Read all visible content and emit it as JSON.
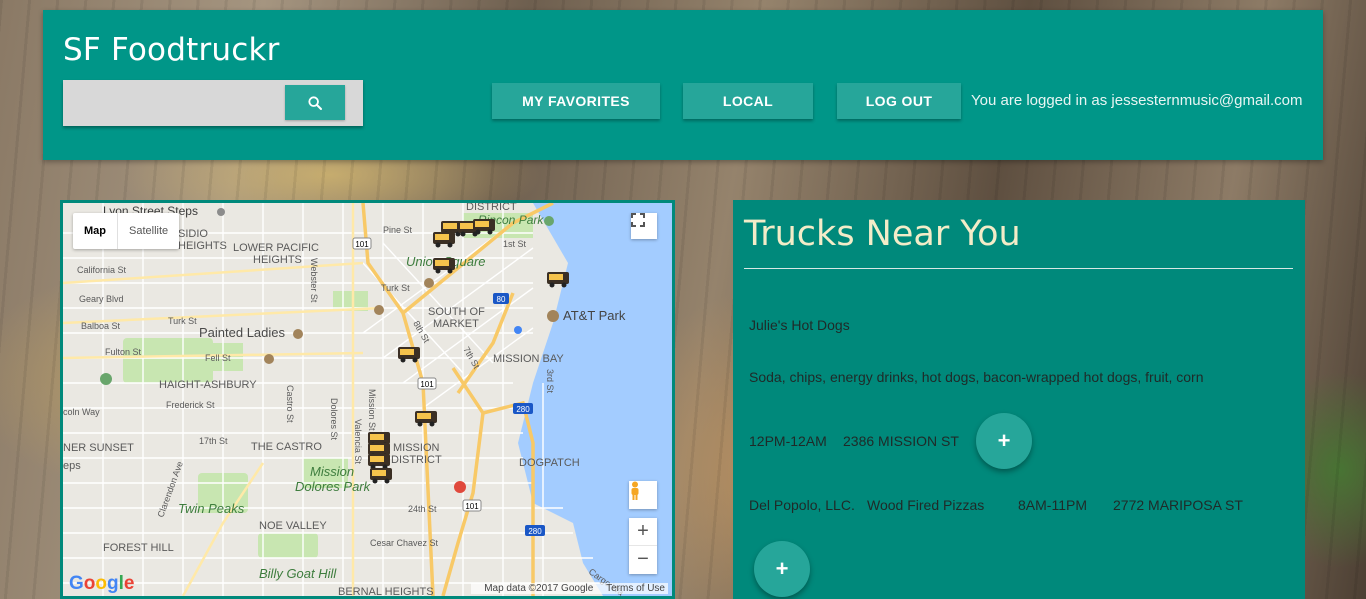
{
  "header": {
    "title": "SF Foodtruckr",
    "search": {
      "value": "",
      "placeholder": ""
    },
    "buttons": {
      "favorites": "MY FAVORITES",
      "local": "LOCAL",
      "logout": "LOG OUT"
    },
    "login_status": "You are logged in as jessesternmusic@gmail.com"
  },
  "map": {
    "type_options": [
      "Map",
      "Satellite"
    ],
    "selected_type": "Map",
    "logo": "Google",
    "attribution": "Map data ©2017 Google",
    "terms": "Terms of Use",
    "labels": {
      "lyon": "Lyon Street Steps",
      "presidio": "SIDIO",
      "heights": "HEIGHTS",
      "lower_pacific": "LOWER PACIFIC",
      "lower_pacific2": "HEIGHTS",
      "california": "California St",
      "geary": "Geary Blvd",
      "balboa": "Balboa St",
      "turk": "Turk St",
      "fulton": "Fulton St",
      "fell": "Fell St",
      "painted_ladies": "Painted Ladies",
      "haight": "HAIGHT-ASHBURY",
      "frederick": "Frederick St",
      "lincoln": "coln Way",
      "inner_sunset": "NER SUNSET",
      "eps": "eps",
      "st17": "17th St",
      "castro": "THE CASTRO",
      "mission_district": "MISSION",
      "mission_district2": "DISTRICT",
      "mission_dolores": "Mission",
      "mission_dolores2": "Dolores Park",
      "twin_peaks": "Twin Peaks",
      "noe_valley": "NOE VALLEY",
      "forest_hill": "FOREST HILL",
      "billy_goat": "Billy Goat Hill",
      "bernal": "BERNAL HEIGHTS",
      "cesar": "Cesar Chavez St",
      "st24": "24th St",
      "pine": "Pine St",
      "union_square": "Union Square",
      "turk2": "Turk St",
      "south_market": "SOUTH OF",
      "south_market2": "MARKET",
      "att_park": "AT&T Park",
      "mission_bay": "MISSION BAY",
      "dogpatch": "DOGPATCH",
      "district": "DISTRICT",
      "rincon": "Rincon Park",
      "st1": "1st St",
      "webster": "Webster St",
      "castro_st": "Castro St",
      "dolores": "Dolores St",
      "valencia": "Valencia St",
      "mission_st": "Mission St",
      "st8": "8th St",
      "st7": "7th St",
      "st3": "3rd St",
      "clarendon": "Clarendon Ave",
      "cargo": "Cargo Wa",
      "hwy101a": "101",
      "hwy101b": "101",
      "hwy101c": "101",
      "hwy80": "80",
      "hwy280a": "280",
      "hwy280b": "280"
    }
  },
  "panel": {
    "title": "Trucks Near You",
    "trucks": [
      {
        "name": "Julie's Hot Dogs",
        "food": "Soda, chips, energy drinks, hot dogs, bacon-wrapped hot dogs, fruit, corn",
        "hours": "12PM-12AM",
        "address": "2386 MISSION ST",
        "add_label": "+"
      },
      {
        "name": "Del Popolo, LLC.",
        "food": "Wood Fired Pizzas",
        "hours": "8AM-11PM",
        "address": "2772 MARIPOSA ST",
        "add_label": "+"
      }
    ]
  },
  "colors": {
    "header_bg": "#009688",
    "button_bg": "#26a69a",
    "panel_bg": "#00897b",
    "panel_title": "#f3ecc8"
  },
  "icons": [
    "search-icon",
    "fullscreen-icon",
    "pegman-icon",
    "truck-marker-icon"
  ]
}
